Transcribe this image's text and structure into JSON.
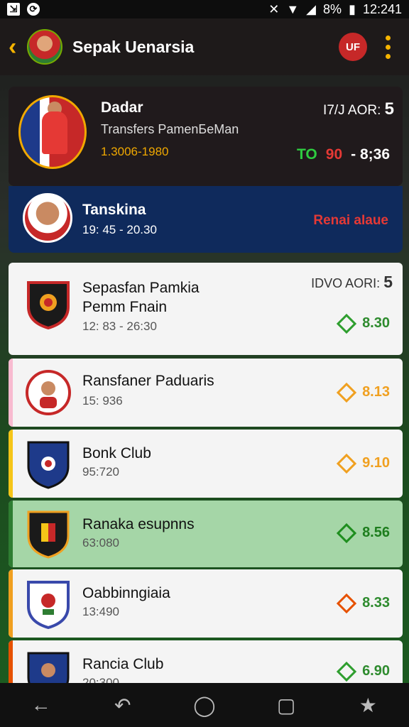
{
  "status_bar": {
    "battery": "8%",
    "time": "12:241"
  },
  "app_bar": {
    "title": "Sepak Uenarsia",
    "logo_text": "UF"
  },
  "featured": {
    "name": "Dadar",
    "subtitle": "Transfers PamenБeMan",
    "date": "1.3006-1980",
    "right_label": "I7/J AOR:",
    "right_number": "5",
    "odds_green": "TO",
    "odds_red": "90",
    "odds_white": "- 8;36"
  },
  "second": {
    "name": "Tanskina",
    "time": "19: 45 - 20.30",
    "status": "Renai aIaue"
  },
  "rows": [
    {
      "name": "Sepasfan Pamkia\nPemm Fnain",
      "time": "12: 83 - 26:30",
      "odds": "8.30",
      "diamond_color": "#2e9e2e",
      "odds_color": "#2e8b2e",
      "accent": "",
      "right_label": "IDVO AORI:",
      "right_number": "5"
    },
    {
      "name": "Ransfaner Paduaris",
      "time": "15: 936",
      "odds": "8.13",
      "diamond_color": "#f0a020",
      "odds_color": "#f0a020",
      "accent": "#f8bbd0"
    },
    {
      "name": "Bonk Club",
      "time": "95:720",
      "odds": "9.10",
      "diamond_color": "#f0a020",
      "odds_color": "#f0a020",
      "accent": "#f5c518"
    },
    {
      "name": "Ranaka esupnns",
      "time": "63:080",
      "odds": "8.56",
      "diamond_color": "#1e8e1e",
      "odds_color": "#1e7e1e",
      "accent": "#2e7d32"
    },
    {
      "name": "Oabbinngiaia",
      "time": "13:490",
      "odds": "8.33",
      "diamond_color": "#e65100",
      "odds_color": "#2e8b2e",
      "accent": "#f0a020"
    },
    {
      "name": "Rancia Club",
      "time": "20:300",
      "odds": "6.90",
      "diamond_color": "#2e9e2e",
      "odds_color": "#2e8b2e",
      "accent": "#e65100"
    }
  ],
  "nav": {
    "back_icon": "back-arrow-icon",
    "undo_icon": "undo-icon",
    "home_icon": "home-icon",
    "recents_icon": "recents-icon",
    "star_icon": "star-icon"
  }
}
